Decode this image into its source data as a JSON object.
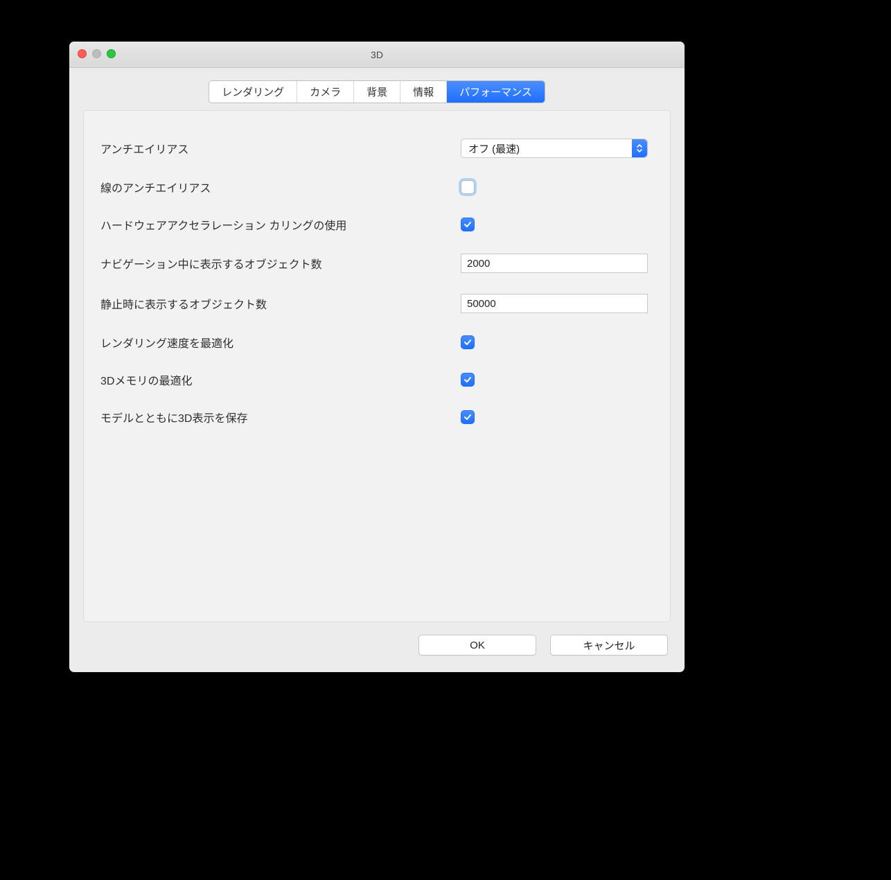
{
  "window": {
    "title": "3D"
  },
  "tabs": {
    "rendering": "レンダリング",
    "camera": "カメラ",
    "background": "背景",
    "info": "情報",
    "performance": "パフォーマンス"
  },
  "form": {
    "antialias_label": "アンチエイリアス",
    "antialias_value": "オフ (最速)",
    "line_antialias_label": "線のアンチエイリアス",
    "line_antialias_checked": false,
    "hw_culling_label": "ハードウェアアクセラレーション カリングの使用",
    "hw_culling_checked": true,
    "nav_objects_label": "ナビゲーション中に表示するオブジェクト数",
    "nav_objects_value": "2000",
    "still_objects_label": "静止時に表示するオブジェクト数",
    "still_objects_value": "50000",
    "optimize_render_label": "レンダリング速度を最適化",
    "optimize_render_checked": true,
    "optimize_memory_label": "3Dメモリの最適化",
    "optimize_memory_checked": true,
    "save_display_label": "モデルとともに3D表示を保存",
    "save_display_checked": true
  },
  "buttons": {
    "ok": "OK",
    "cancel": "キャンセル"
  }
}
